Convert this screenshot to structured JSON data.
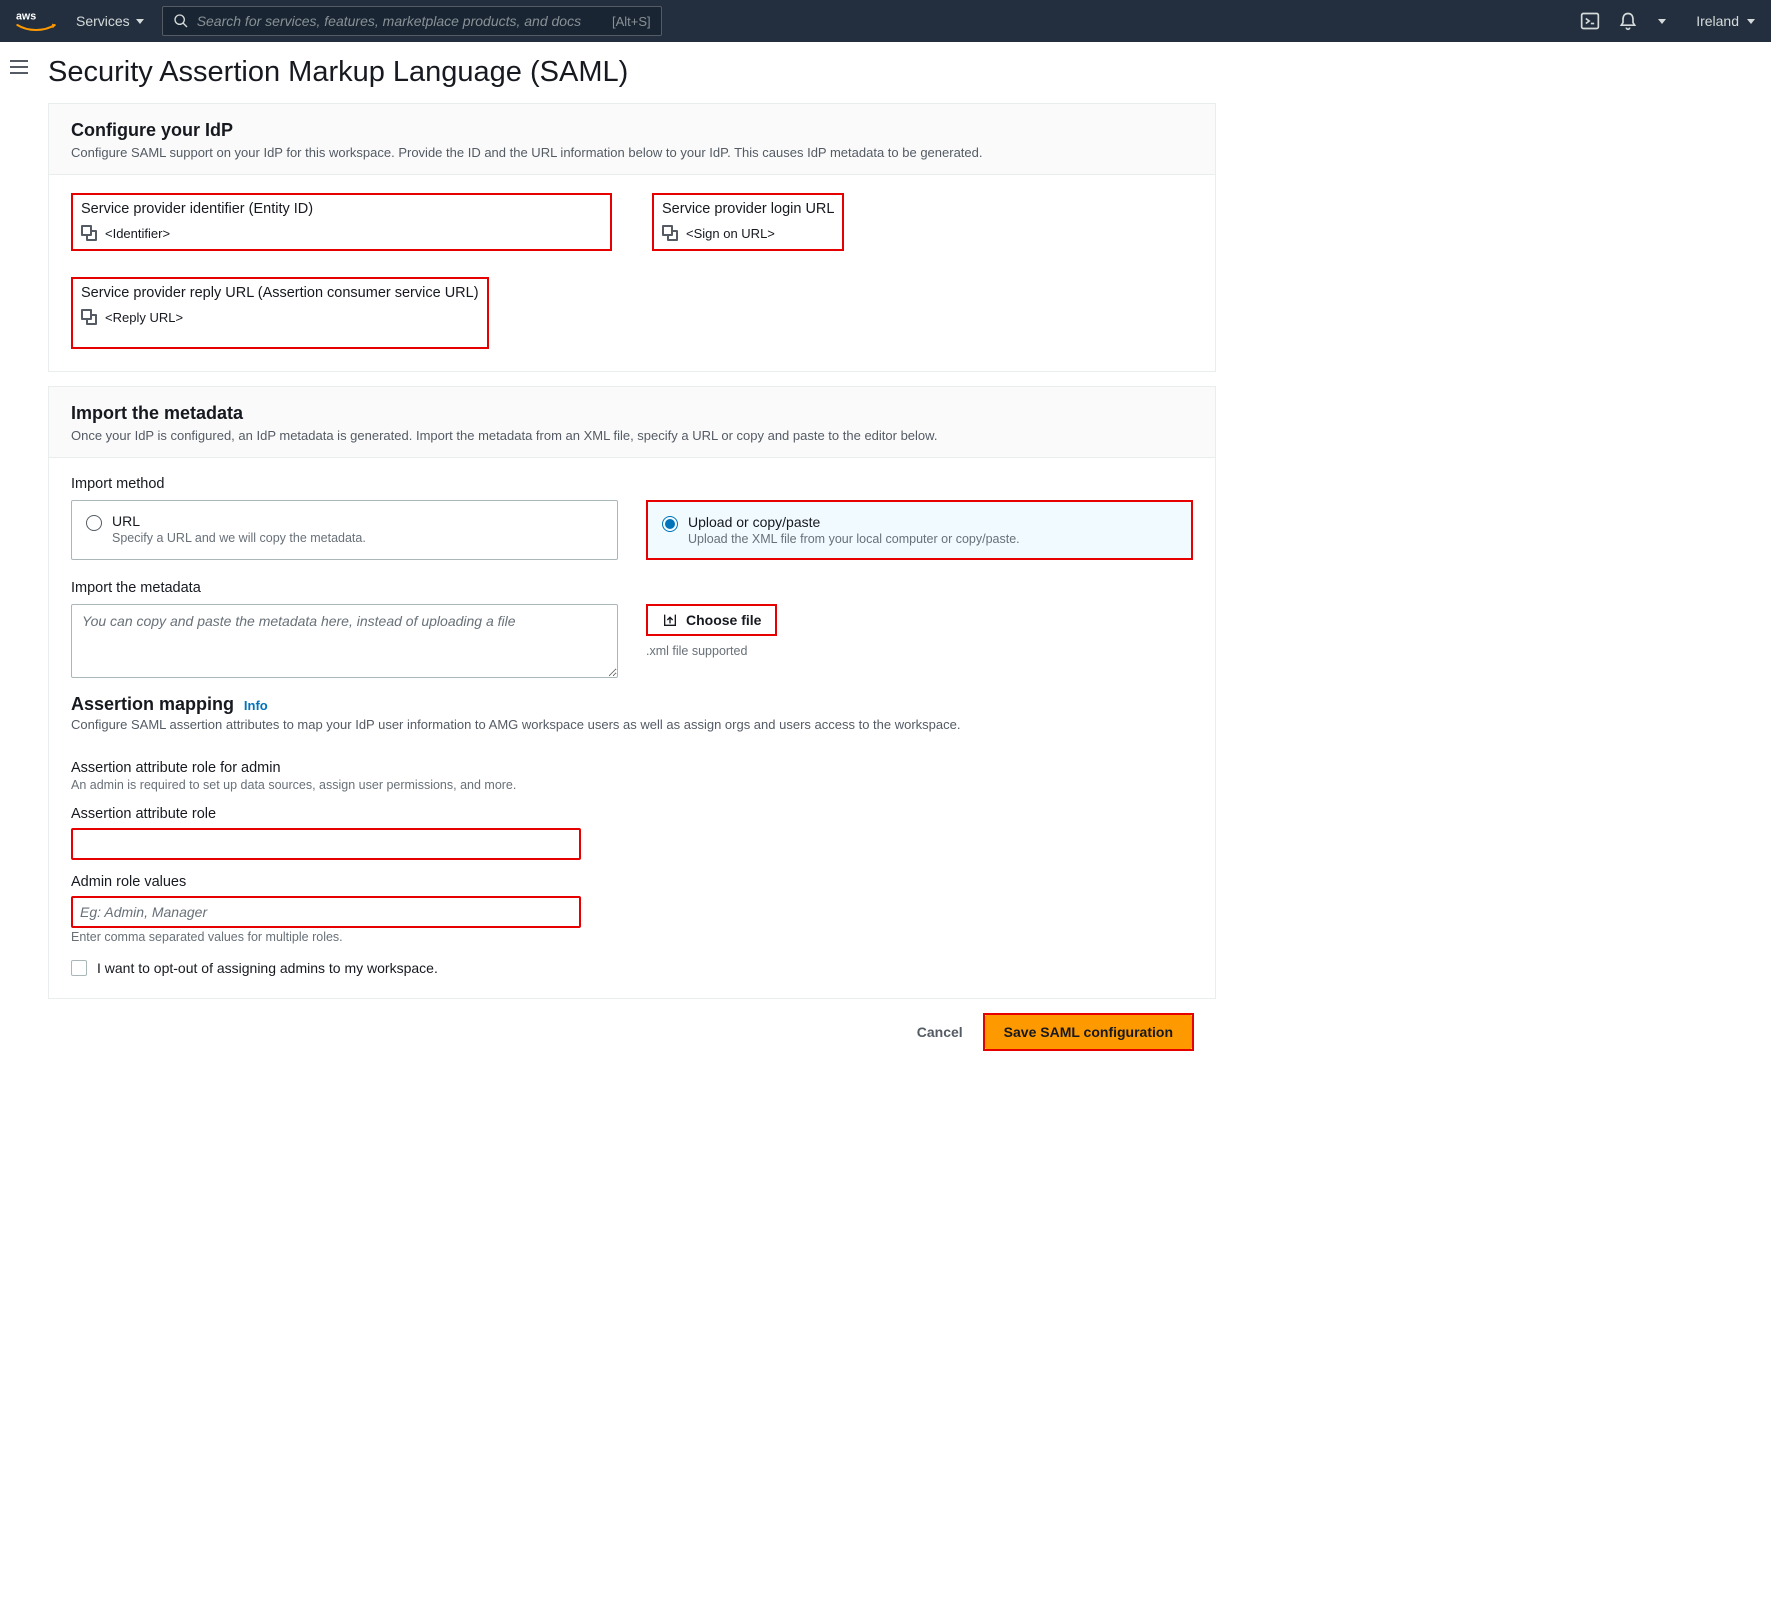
{
  "nav": {
    "services_label": "Services",
    "search_placeholder": "Search for services, features, marketplace products, and docs",
    "search_shortcut": "[Alt+S]",
    "region": "Ireland"
  },
  "page": {
    "title": "Security Assertion Markup Language (SAML)"
  },
  "configure": {
    "heading": "Configure your IdP",
    "description": "Configure SAML support on your IdP for this workspace. Provide the ID and the URL information below to your IdP. This causes IdP metadata to be generated.",
    "entity_id_label": "Service provider identifier (Entity ID)",
    "entity_id_value": "<Identifier>",
    "login_url_label": "Service provider login URL",
    "login_url_value": "<Sign on URL>",
    "reply_url_label": "Service provider reply URL (Assertion consumer service URL)",
    "reply_url_value": "<Reply URL>"
  },
  "import": {
    "heading": "Import the metadata",
    "description": "Once your IdP is configured, an IdP metadata is generated. Import the metadata from an XML file, specify a URL or copy and paste to the editor below.",
    "method_label": "Import method",
    "option_url_title": "URL",
    "option_url_sub": "Specify a URL and we will copy the metadata.",
    "option_upload_title": "Upload or copy/paste",
    "option_upload_sub": "Upload the XML file from your local computer or copy/paste.",
    "textarea_label": "Import the metadata",
    "textarea_placeholder": "You can copy and paste the metadata here, instead of uploading a file",
    "choose_file_label": "Choose file",
    "choose_file_hint": ".xml file supported"
  },
  "mapping": {
    "heading": "Assertion mapping",
    "info": "Info",
    "description": "Configure SAML assertion attributes to map your IdP user information to AMG workspace users as well as assign orgs and users access to the workspace.",
    "admin_role_section": "Assertion attribute role for admin",
    "admin_role_section_desc": "An admin is required to set up data sources, assign user permissions, and more.",
    "attr_role_label": "Assertion attribute role",
    "admin_role_values_label": "Admin role values",
    "admin_role_values_placeholder": "Eg: Admin, Manager",
    "admin_role_values_hint": "Enter comma separated values for multiple roles.",
    "optout_label": "I want to opt-out of assigning admins to my workspace."
  },
  "footer": {
    "cancel": "Cancel",
    "save": "Save SAML configuration"
  }
}
